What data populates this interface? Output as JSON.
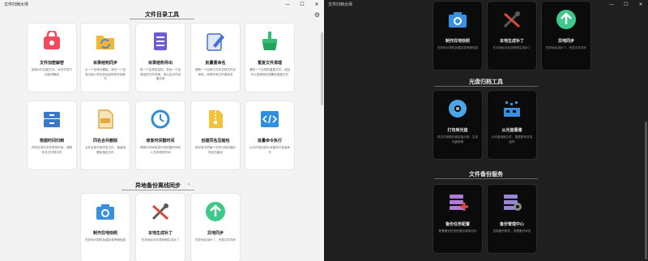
{
  "app": {
    "title": "文件归档大师",
    "controls": [
      "—",
      "☐",
      "✕"
    ]
  },
  "light": {
    "sections": {
      "file_tools": "文件目录工具",
      "async_backup": "异地备份离线同步"
    },
    "cards": [
      {
        "title": "文件加密解密",
        "desc": "使用AES加密方法，对文件进行加密或解密",
        "icon": "lock-bag-icon",
        "color": "#ef4b5c"
      },
      {
        "title": "目录结构同步",
        "desc": "以一个目录为模板，将另一个目录中缺少的目录及结构同步到其中",
        "icon": "sync-folder-icon",
        "color": "#f2b632"
      },
      {
        "title": "目录结构导出",
        "desc": "将一个目录的结构，导出一个目录结构文件存储，或以此文件创建目录",
        "icon": "list-doc-icon",
        "color": "#6a5bd6"
      },
      {
        "title": "批量重命名",
        "desc": "按照一个目录中文件名称文件名修改，修改所有文件重命名",
        "icon": "pencil-doc-icon",
        "color": "#4a6fd4"
      },
      {
        "title": "重复文件清理",
        "desc": "清除一个目录的重复文件，然后可以选择保存或删除重复文件",
        "icon": "broom-icon",
        "color": "#2fbf71"
      },
      {
        "title": "根据时间归档",
        "desc": "识别目录中文件修改时间，按照年月日归档文件",
        "icon": "cabinet-icon",
        "color": "#3a79c9"
      },
      {
        "title": "同名合并删除",
        "desc": "合并目录中的同名文件，保留或删除指定文件",
        "icon": "jpg-file-icon",
        "color": "#e2a93b"
      },
      {
        "title": "修复时间戳时间",
        "desc": "将照片时间信息中的拍摄时间写入文件修改时间",
        "icon": "clock-icon",
        "color": "#2e8fd8"
      },
      {
        "title": "创建同名压缩包",
        "desc": "将目录中的每个文件分别压缩为同名压缩包",
        "icon": "zip-icon",
        "color": "#f2c23a"
      },
      {
        "title": "批量命令执行",
        "desc": "以文件或目录为对象执行批量命令",
        "icon": "code-icon",
        "color": "#2f8fe0"
      },
      {
        "title": "制作异地快照",
        "desc": "在异地计算机创建目录快照信息",
        "icon": "camera-icon",
        "color": "#3b8fe0"
      },
      {
        "title": "本地生成补丁",
        "desc": "在本地比对目录快照生成补丁",
        "icon": "tools-icon",
        "color": "#d94a3a"
      },
      {
        "title": "异地同步",
        "desc": "在异地应用补丁，完成文件同步",
        "icon": "arrow-up-icon",
        "color": "#3cc98a"
      }
    ]
  },
  "dark": {
    "sections": {
      "disk_tools": "光盘归档工具",
      "backup_service": "文件备份服务"
    },
    "cards": [
      {
        "title": "制作异地快照",
        "desc": "在异地计算机创建目录快照信息",
        "icon": "camera-icon",
        "color": "#3b8fe0"
      },
      {
        "title": "本地生成补丁",
        "desc": "在本地比对目录快照生成补丁",
        "icon": "tools-icon",
        "color": "#d94a3a"
      },
      {
        "title": "异地同步",
        "desc": "在异地应用补丁，完成文件同步",
        "icon": "arrow-up-icon",
        "color": "#3cc98a"
      },
      {
        "title": "打包到光盘",
        "desc": "将文件按照光盘容量分卷，生成光盘映像",
        "icon": "disc-icon",
        "color": "#4aa6e8"
      },
      {
        "title": "从光盘重建",
        "desc": "从光盘读取文件，重建原有目录结构",
        "icon": "rebuild-icon",
        "color": "#3b8fe0"
      },
      {
        "title": "备份任务配置",
        "desc": "配置备份任务的源目录和目标",
        "icon": "backup-config-icon",
        "color": "#b07ad8"
      },
      {
        "title": "备份管理中心",
        "desc": "控制备份服务，查看备份状态",
        "icon": "backup-center-icon",
        "color": "#9a84d8"
      }
    ]
  }
}
